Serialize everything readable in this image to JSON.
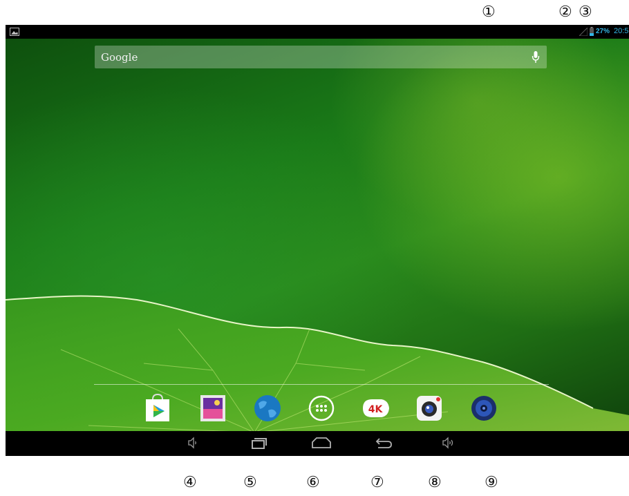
{
  "annotations": {
    "top": [
      "①",
      "②",
      "③"
    ],
    "bottom": [
      "④",
      "⑤",
      "⑥",
      "⑦",
      "⑧",
      "⑨"
    ]
  },
  "status_bar": {
    "battery": "27%",
    "time": "20:5",
    "icons": [
      "gallery-notification-icon",
      "signal-icon",
      "battery-icon"
    ]
  },
  "search": {
    "label": "Google",
    "mic_icon": "mic-icon"
  },
  "dock": {
    "apps": [
      {
        "name": "play-store-icon"
      },
      {
        "name": "gallery-icon"
      },
      {
        "name": "browser-icon"
      },
      {
        "name": "all-apps-icon"
      },
      {
        "name": "4k-video-icon",
        "label": "4K"
      },
      {
        "name": "camera-icon"
      },
      {
        "name": "music-icon"
      }
    ]
  },
  "nav_bar": {
    "buttons": [
      "volume-down-icon",
      "recent-apps-icon",
      "home-icon",
      "back-icon",
      "volume-up-icon"
    ]
  },
  "colors": {
    "status_accent": "#33b5e5",
    "wallpaper_green": "#1a7a18"
  }
}
